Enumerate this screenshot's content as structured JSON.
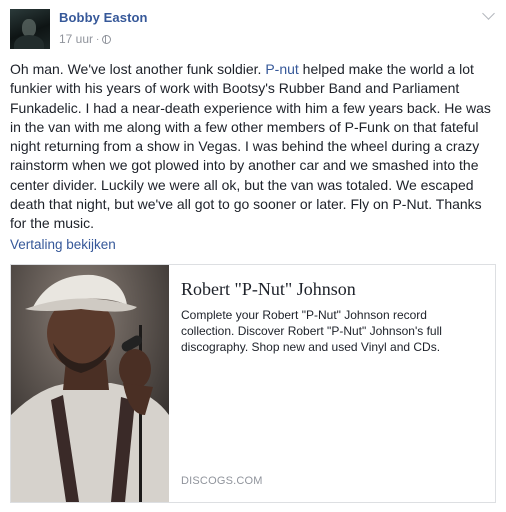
{
  "post": {
    "author": "Bobby Easton",
    "time": "17 uur",
    "separator": "·",
    "text_before_link": "Oh man. We've lost another funk soldier. ",
    "link_text": "P-nut",
    "text_after_link": " helped make the world a lot funkier with his years of work with Bootsy's Rubber Band and Parliament Funkadelic. I had a near-death experience with him a few years back. He was in the van with me along with a few other members of P-Funk on that fateful night returning from a show in Vegas. I was behind the wheel during a crazy rainstorm when we got plowed into by another car and we smashed into the center divider. Luckily we were all ok, but the van was totaled. We escaped death that night, but we've all got to go sooner or later. Fly on P-Nut. Thanks for the music.",
    "translate_label": "Vertaling bekijken"
  },
  "link_card": {
    "title": "Robert \"P-Nut\" Johnson",
    "description": "Complete your Robert \"P-Nut\" Johnson record collection. Discover Robert \"P-Nut\" Johnson's full discography. Shop new and used Vinyl and CDs.",
    "domain": "DISCOGS.COM"
  },
  "icons": {
    "audience": "globe-icon",
    "options": "chevron-down-icon"
  },
  "colors": {
    "link": "#365899",
    "meta": "#90949c",
    "text": "#1d2129",
    "border": "#dddfe2"
  }
}
